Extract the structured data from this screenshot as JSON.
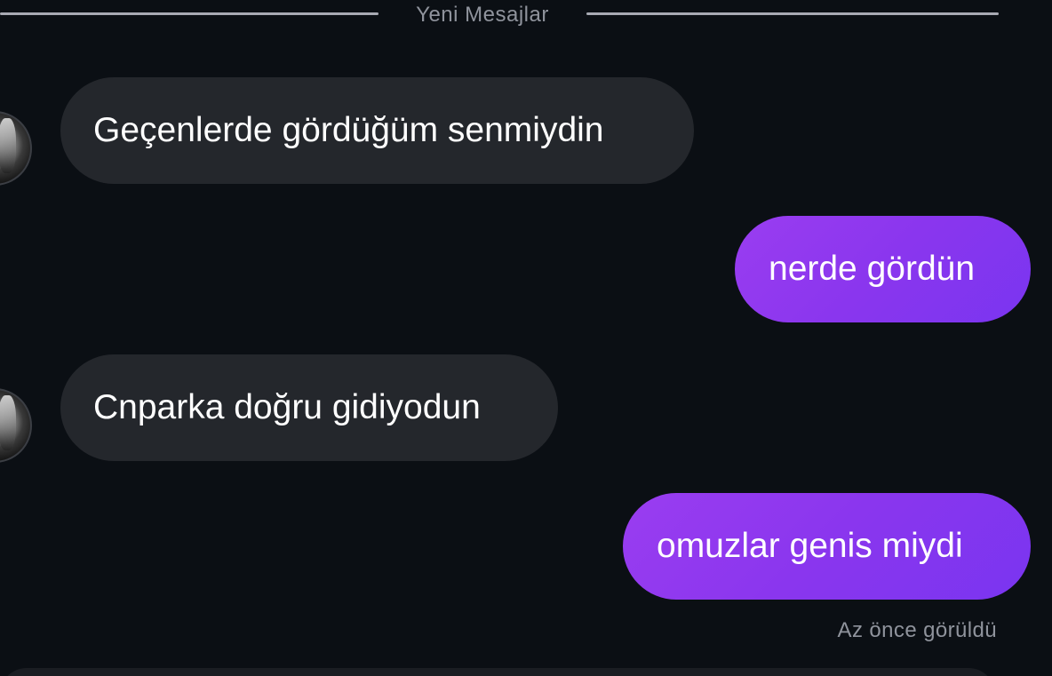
{
  "divider": {
    "label": "Yeni Mesajlar"
  },
  "messages": [
    {
      "direction": "incoming",
      "text": "Geçenlerde gördüğüm senmiydin"
    },
    {
      "direction": "outgoing",
      "text": "nerde gördün"
    },
    {
      "direction": "incoming",
      "text": "Cnparka doğru gidiyodun"
    },
    {
      "direction": "outgoing",
      "text": "omuzlar genis miydi"
    }
  ],
  "status": {
    "seen": "Az önce görüldü"
  },
  "colors": {
    "background": "#0b0f14",
    "incoming_bubble": "#24272c",
    "outgoing_bubble": "#8a36ee",
    "muted_text": "#8f939c"
  }
}
